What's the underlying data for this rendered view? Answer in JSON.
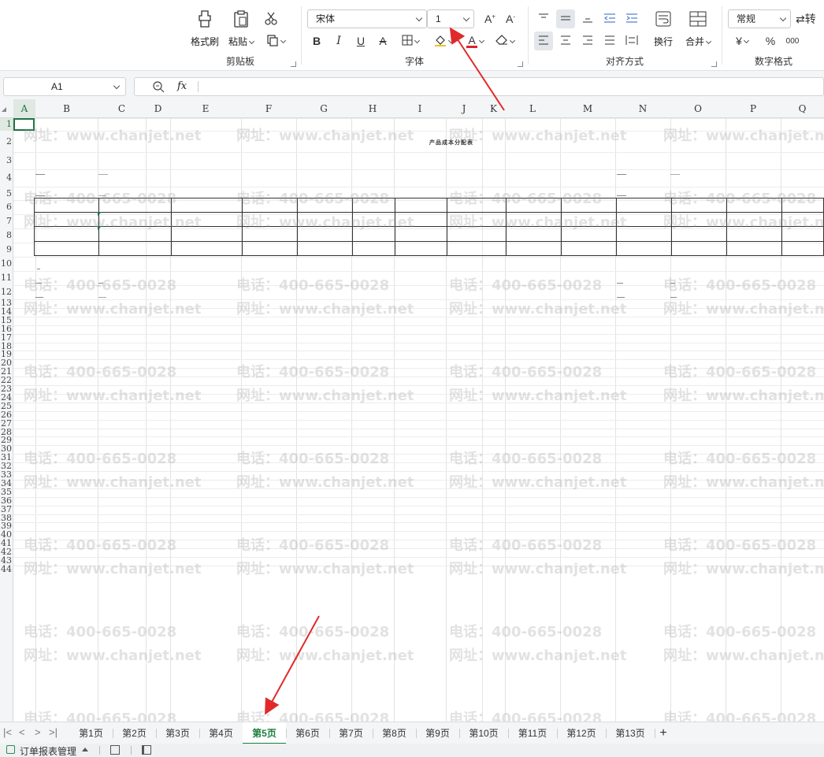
{
  "ribbon": {
    "clipboard": {
      "group_label": "剪贴板",
      "format_painter": "格式刷",
      "paste": "粘贴"
    },
    "font": {
      "group_label": "字体",
      "font_name": "宋体",
      "font_size": "1",
      "bold": "B",
      "italic": "I",
      "underline": "U",
      "strike": "A",
      "font_color_letter": "A"
    },
    "align": {
      "group_label": "对齐方式",
      "wrap": "换行",
      "merge": "合并"
    },
    "number": {
      "group_label": "数字格式",
      "format": "常规",
      "currency": "¥",
      "percent": "%",
      "thousand": "000",
      "convert": "转"
    }
  },
  "formula_bar": {
    "cell_ref": "A1",
    "fx": "fx",
    "content": ""
  },
  "columns": [
    "A",
    "B",
    "C",
    "D",
    "E",
    "F",
    "G",
    "H",
    "I",
    "J",
    "K",
    "L",
    "M",
    "N",
    "O",
    "P",
    "Q"
  ],
  "rows": [
    "1",
    "2",
    "3",
    "4",
    "5",
    "6",
    "7",
    "8",
    "9",
    "10",
    "11",
    "12",
    "13",
    "14",
    "15",
    "16",
    "17",
    "18",
    "19",
    "20",
    "21",
    "22",
    "23",
    "24",
    "25",
    "26",
    "27",
    "28",
    "29",
    "30",
    "31",
    "32",
    "33",
    "34",
    "35",
    "36",
    "37",
    "38",
    "39",
    "40",
    "41",
    "42",
    "43",
    "44"
  ],
  "sheet": {
    "doc_title": "产品成本分配表"
  },
  "watermark": {
    "phone": "电话：400-665-0028",
    "site": "网址：www.chanjet.net"
  },
  "tabs": [
    "第1页",
    "第2页",
    "第3页",
    "第4页",
    "第5页",
    "第6页",
    "第7页",
    "第8页",
    "第9页",
    "第10页",
    "第11页",
    "第12页",
    "第13页"
  ],
  "active_tab": "第5页",
  "add_tab": "+",
  "status": {
    "workbook": "订单报表管理"
  },
  "colors": {
    "accent_green": "#217346",
    "arrow_red": "#e02a2a",
    "font_color_bar": "#d9232d"
  }
}
